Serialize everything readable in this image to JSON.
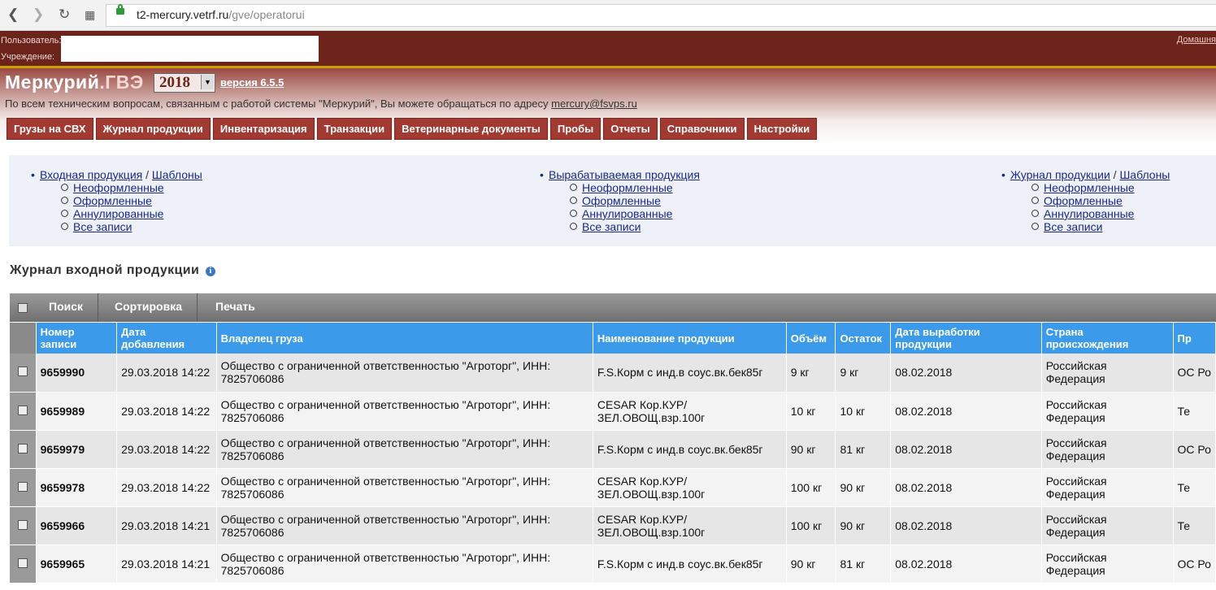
{
  "browser": {
    "url_host": "t2-mercury.vetrf.ru",
    "url_path": "/gve/operatorui"
  },
  "topbar": {
    "user_label": "Пользователь:",
    "org_label": "Учреждение:",
    "home_link": "Домашня"
  },
  "header": {
    "brand": "Меркурий",
    "brand_suffix": ".ГВЭ",
    "year": "2018",
    "version": "версия 6.5.5",
    "support_text": "По всем техническим вопросам, связанным с работой системы \"Меркурий\", Вы можете обращаться по адресу ",
    "support_email": "mercury@fsvps.ru"
  },
  "menu": [
    "Грузы на СВХ",
    "Журнал продукции",
    "Инвентаризация",
    "Транзакции",
    "Ветеринарные документы",
    "Пробы",
    "Отчеты",
    "Справочники",
    "Настройки"
  ],
  "links": {
    "col1": {
      "top": "Входная продукция",
      "sep": "/",
      "top2": "Шаблоны",
      "subs": [
        "Неоформленные",
        "Оформленные",
        "Аннулированные",
        "Все записи"
      ]
    },
    "col2": {
      "top": "Вырабатываемая продукция",
      "subs": [
        "Неоформленные",
        "Оформленные",
        "Аннулированные",
        "Все записи"
      ]
    },
    "col3": {
      "top": "Журнал продукции",
      "sep": "/",
      "top2": "Шаблоны",
      "subs": [
        "Неоформленные",
        "Оформленные",
        "Аннулированные",
        "Все записи"
      ]
    }
  },
  "section_title": "Журнал входной продукции",
  "toolbar": {
    "search": "Поиск",
    "sort": "Сортировка",
    "print": "Печать"
  },
  "table": {
    "headers": [
      "Номер записи",
      "Дата добавления",
      "Владелец груза",
      "Наименование продукции",
      "Объём",
      "Остаток",
      "Дата выработки продукции",
      "Страна происхождения",
      "Пр"
    ],
    "rows": [
      [
        "9659990",
        "29.03.2018 14:22",
        "Общество с ограниченной ответственностью \"Агроторг\", ИНН: 7825706086",
        "F.S.Корм с инд.в соус.вк.бек85г",
        "9 кг",
        "9 кг",
        "08.02.2018",
        "Российская Федерация",
        "ОС Ро"
      ],
      [
        "9659989",
        "29.03.2018 14:22",
        "Общество с ограниченной ответственностью \"Агроторг\", ИНН: 7825706086",
        "CESAR Кор.КУР/ЗЕЛ.ОВОЩ.взр.100г",
        "10 кг",
        "10 кг",
        "08.02.2018",
        "Российская Федерация",
        "Те"
      ],
      [
        "9659979",
        "29.03.2018 14:22",
        "Общество с ограниченной ответственностью \"Агроторг\", ИНН: 7825706086",
        "F.S.Корм с инд.в соус.вк.бек85г",
        "90 кг",
        "81 кг",
        "08.02.2018",
        "Российская Федерация",
        "ОС Ро"
      ],
      [
        "9659978",
        "29.03.2018 14:22",
        "Общество с ограниченной ответственностью \"Агроторг\", ИНН: 7825706086",
        "CESAR Кор.КУР/ЗЕЛ.ОВОЩ.взр.100г",
        "100 кг",
        "90 кг",
        "08.02.2018",
        "Российская Федерация",
        "Те"
      ],
      [
        "9659966",
        "29.03.2018 14:21",
        "Общество с ограниченной ответственностью \"Агроторг\", ИНН: 7825706086",
        "CESAR Кор.КУР/ЗЕЛ.ОВОЩ.взр.100г",
        "100 кг",
        "90 кг",
        "08.02.2018",
        "Российская Федерация",
        "Те"
      ],
      [
        "9659965",
        "29.03.2018 14:21",
        "Общество с ограниченной ответственностью \"Агроторг\", ИНН: 7825706086",
        "F.S.Корм с инд.в соус.вк.бек85г",
        "90 кг",
        "81 кг",
        "08.02.2018",
        "Российская Федерация",
        "ОС Ро"
      ]
    ]
  }
}
